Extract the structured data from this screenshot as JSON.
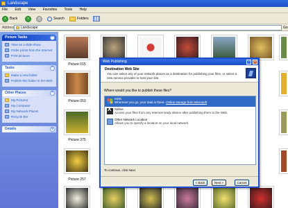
{
  "window": {
    "title": "Landscape"
  },
  "menu": [
    "File",
    "Edit",
    "View",
    "Favorites",
    "Tools",
    "Help"
  ],
  "toolbar": {
    "back_label": "Back",
    "search_label": "Search",
    "folders_label": "Folders"
  },
  "address": {
    "label": "Address",
    "value": "Landscape",
    "go_label": "Go"
  },
  "taskpane": {
    "picture_tasks": {
      "title": "Picture Tasks",
      "items": [
        "View as a slide show",
        "Order prints from the Internet",
        "Print pictures"
      ]
    },
    "tasks": {
      "title": "Tasks",
      "items": [
        "Make a new folder",
        "Publish this folder to the Web"
      ]
    },
    "other_places": {
      "title": "Other Places",
      "items": [
        "My Pictures",
        "My Computer",
        "My Network Places",
        "Recycle Bin"
      ]
    },
    "details": {
      "title": "Details"
    }
  },
  "files": {
    "captions": [
      "Picture 015",
      "Picture 053",
      "Picture 375",
      "Picture 257"
    ]
  },
  "dialog": {
    "title": "Web Publishing",
    "help_label": "?",
    "close_label": "X",
    "header_title": "Destination Web Site",
    "header_desc": "You can select any of your network places as a destination for publishing your files, or select a new service provider to host your site.",
    "question": "Where would you like to publish these files?",
    "providers": [
      {
        "name": "MSN",
        "desc": "Wherever you go, your data is there.",
        "link": "Online storage from Microsoft"
      },
      {
        "name": "Xdrive",
        "desc": "Access your files from any Internet-ready device after publishing them to the Web."
      },
      {
        "name": "Other Network Location",
        "desc": "Allows you to specify a location on your local network."
      }
    ],
    "continue_text": "To continue, click Next.",
    "back_button": "< Back",
    "next_button": "Next >",
    "cancel_button": "Cancel"
  }
}
